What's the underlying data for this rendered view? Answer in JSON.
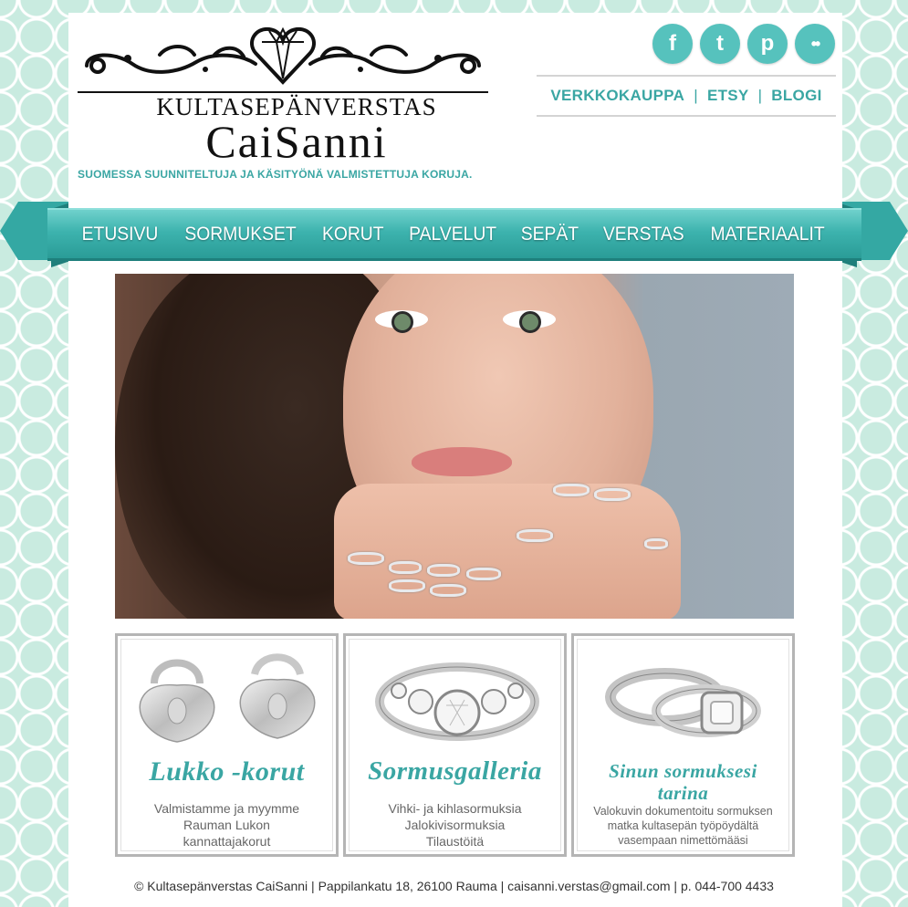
{
  "header": {
    "brand_top": "KULTASEPÄNVERSTAS",
    "brand_main": "CaiSanni",
    "tagline": "SUOMESSA SUUNNITELTUJA JA KÄSITYÖNÄ VALMISTETTUJA KORUJA."
  },
  "social": [
    {
      "icon": "facebook-icon",
      "glyph": "f"
    },
    {
      "icon": "twitter-icon",
      "glyph": "t"
    },
    {
      "icon": "pinterest-icon",
      "glyph": "p"
    },
    {
      "icon": "flickr-icon",
      "glyph": "••"
    }
  ],
  "toplinks": {
    "verkkokauppa": "VERKKOKAUPPA",
    "etsy": "ETSY",
    "blogi": "BLOGI",
    "separator": "|"
  },
  "nav": [
    "ETUSIVU",
    "SORMUKSET",
    "KORUT",
    "PALVELUT",
    "SEPÄT",
    "VERSTAS",
    "MATERIAALIT"
  ],
  "features": [
    {
      "title": "Lukko -korut",
      "lines": [
        "Valmistamme ja myymme",
        "Rauman Lukon",
        "kannattajakorut"
      ]
    },
    {
      "title": "Sormusgalleria",
      "lines": [
        "Vihki- ja kihlasormuksia",
        "Jalokivisormuksia",
        "Tilaustöitä"
      ]
    },
    {
      "title_line1": "Sinun sormuksesi",
      "title_line2": "tarina",
      "lines": [
        "Valokuvin dokumentoitu sormuksen",
        "matka kultasepän työpöydältä",
        "vasempaan nimettömääsi"
      ]
    }
  ],
  "footer": "© Kultasepänverstas CaiSanni | Pappilankatu 18, 26100 Rauma | caisanni.verstas@gmail.com | p. 044-700 4433",
  "colors": {
    "accent": "#3aa6a3",
    "social": "#56c2bd",
    "background": "#c9ebe0"
  }
}
